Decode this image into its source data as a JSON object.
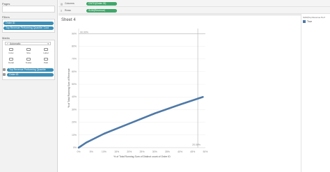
{
  "left_panel": {
    "pages_title": "Pages",
    "filters_title": "Filters",
    "filters": [
      "Order ID",
      "Top Revenue Performing Quantile: Cust"
    ],
    "marks_title": "Marks",
    "mark_type": "Automatic",
    "mark_buttons": [
      "Color",
      "Size",
      "Label",
      "Detail",
      "Tooltip",
      "Path"
    ],
    "mark_fields": [
      "Top Revenue Performing Quantile",
      "Order ID"
    ]
  },
  "shelves": {
    "columns_label": "Columns",
    "columns_pill": "CNTD(Order ID)",
    "rows_label": "Rows",
    "rows_pill": "SUM(Revenue)"
  },
  "sheet": {
    "title": "Sheet 4"
  },
  "chart_data": {
    "type": "line",
    "xlabel": "% of Total Running Sum of Distinct count of Order ID",
    "ylabel": "% of Total Running Sum of Revenue",
    "x_ticks": [
      "0%",
      "5%",
      "10%",
      "15%",
      "20%",
      "25%",
      "30%",
      "35%",
      "40%",
      "45%",
      "50%"
    ],
    "y_ticks": [
      "0%",
      "10%",
      "20%",
      "30%",
      "40%",
      "50%",
      "60%",
      "70%",
      "80%",
      "90%"
    ],
    "xlim": [
      0,
      50
    ],
    "ylim": [
      0,
      94
    ],
    "ref_line_y": {
      "value": 90,
      "label": "90.00%"
    },
    "ref_line_x": {
      "value": 47,
      "label": "20.00%"
    },
    "series": [
      {
        "x": [
          0,
          3,
          10,
          20,
          30,
          40,
          49
        ],
        "y": [
          0,
          4,
          11,
          19,
          27,
          34,
          40
        ]
      }
    ],
    "colors": {
      "line": "#4e79a7",
      "ref": "#b0b0b0"
    }
  },
  "legend": {
    "title": "SUM(Top Revenue Perf",
    "item_label": "True",
    "item_color": "#4e79a7"
  }
}
